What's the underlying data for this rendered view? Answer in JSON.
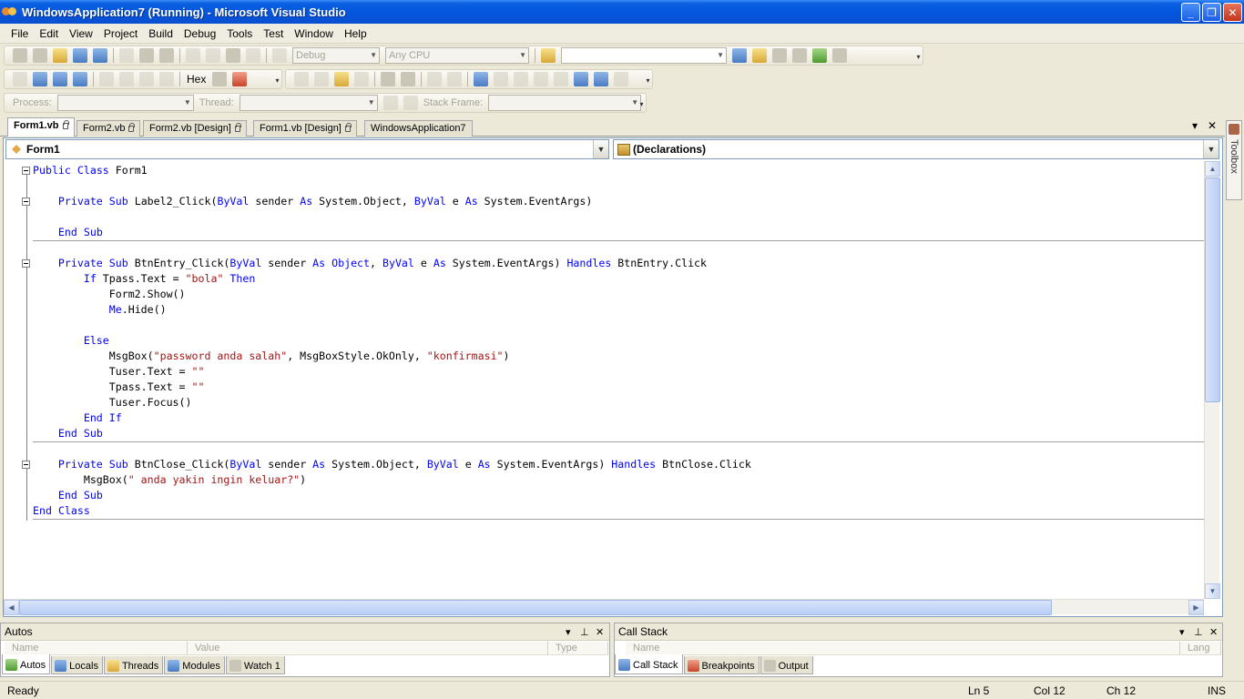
{
  "window": {
    "title": "WindowsApplication7 (Running) - Microsoft Visual Studio",
    "minimize": "_",
    "maximize": "❐",
    "close": "✕"
  },
  "menu": [
    "File",
    "Edit",
    "View",
    "Project",
    "Build",
    "Debug",
    "Tools",
    "Test",
    "Window",
    "Help"
  ],
  "toolbar": {
    "config": "Debug",
    "platform": "Any CPU",
    "hex": "Hex",
    "process_label": "Process:",
    "thread_label": "Thread:",
    "stack_frame_label": "Stack Frame:"
  },
  "tabs": [
    {
      "label": "Form1.vb",
      "active": true
    },
    {
      "label": "Form2.vb",
      "active": false
    },
    {
      "label": "Form2.vb [Design]",
      "active": false
    },
    {
      "label": "Form1.vb [Design]",
      "active": false
    },
    {
      "label": "WindowsApplication7",
      "active": false
    }
  ],
  "nav": {
    "class_combo": "Form1",
    "member_combo": "(Declarations)"
  },
  "toolbox_label": "Toolbox",
  "code": {
    "l1": [
      "Public",
      " ",
      "Class",
      " Form1"
    ],
    "l2": [
      "    ",
      "Private",
      " ",
      "Sub",
      " Label2_Click(",
      "ByVal",
      " sender ",
      "As",
      " System.Object, ",
      "ByVal",
      " e ",
      "As",
      " System.EventArgs)"
    ],
    "l3": [
      "    ",
      "End",
      " ",
      "Sub"
    ],
    "l4": [
      "    ",
      "Private",
      " ",
      "Sub",
      " BtnEntry_Click(",
      "ByVal",
      " sender ",
      "As",
      " ",
      "Object",
      ", ",
      "ByVal",
      " e ",
      "As",
      " System.EventArgs) ",
      "Handles",
      " BtnEntry.Click"
    ],
    "l5": [
      "        ",
      "If",
      " Tpass.Text = ",
      "\"bola\"",
      " ",
      "Then"
    ],
    "l6": [
      "            Form2.Show()"
    ],
    "l7": [
      "            ",
      "Me",
      ".Hide()"
    ],
    "l8": [
      "        ",
      "Else"
    ],
    "l9": [
      "            MsgBox(",
      "\"password anda salah\"",
      ", MsgBoxStyle.OkOnly, ",
      "\"konfirmasi\"",
      ")"
    ],
    "l10": [
      "            Tuser.Text = ",
      "\"\""
    ],
    "l11": [
      "            Tpass.Text = ",
      "\"\""
    ],
    "l12": [
      "            Tuser.Focus()"
    ],
    "l13": [
      "        ",
      "End",
      " ",
      "If"
    ],
    "l14": [
      "    ",
      "End",
      " ",
      "Sub"
    ],
    "l15": [
      "    ",
      "Private",
      " ",
      "Sub",
      " BtnClose_Click(",
      "ByVal",
      " sender ",
      "As",
      " System.Object, ",
      "ByVal",
      " e ",
      "As",
      " System.EventArgs) ",
      "Handles",
      " BtnClose.Click"
    ],
    "l16": [
      "        MsgBox(",
      "\" anda yakin ingin keluar?\"",
      ")"
    ],
    "l17": [
      "    ",
      "End",
      " ",
      "Sub"
    ],
    "l18": [
      "End",
      " ",
      "Class"
    ]
  },
  "autos_panel": {
    "title": "Autos",
    "columns": [
      "Name",
      "Value",
      "Type"
    ],
    "tabs": [
      "Autos",
      "Locals",
      "Threads",
      "Modules",
      "Watch 1"
    ]
  },
  "callstack_panel": {
    "title": "Call Stack",
    "columns": [
      "Name",
      "Lang"
    ],
    "tabs": [
      "Call Stack",
      "Breakpoints",
      "Output"
    ]
  },
  "status": {
    "text": "Ready",
    "ln": "Ln 5",
    "col": "Col 12",
    "ch": "Ch 12",
    "mode": "INS"
  }
}
